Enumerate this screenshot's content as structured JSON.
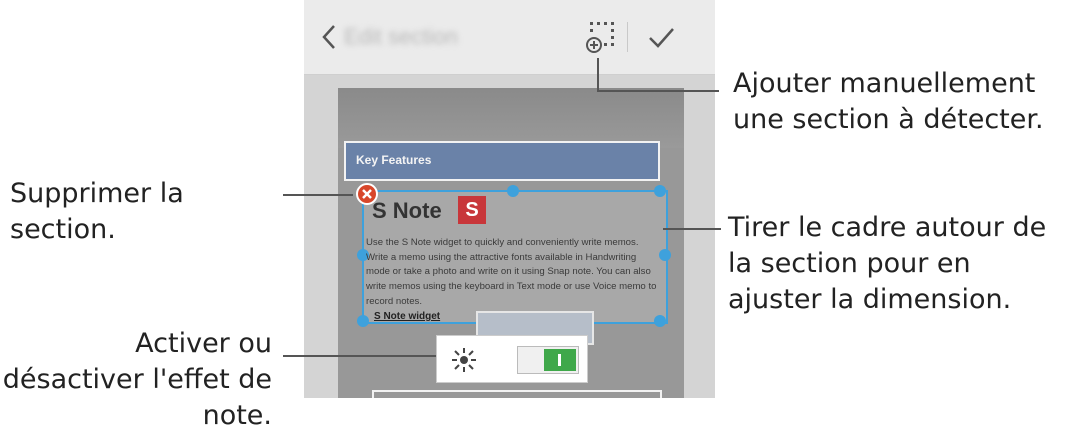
{
  "app": {
    "title": "Edit section",
    "back_label": "<",
    "add_section_icon": "add-section-icon",
    "done_icon": "checkmark-icon"
  },
  "document": {
    "key_features": "Key Features",
    "snote_title": "S Note",
    "snote_logo": "S",
    "snote_paragraph": "Use the S Note widget to quickly and conveniently write memos. Write a memo using the attractive fonts available in Handwriting mode or take a photo and write on it using Snap note. You can also write memos using the keyboard in Text mode or use Voice memo to record notes.",
    "snote_widget": "S Note widget"
  },
  "toggle": {
    "icon": "note-effect-icon",
    "state": "on"
  },
  "callouts": {
    "add_section": "Ajouter manuellement une section à détecter.",
    "delete_section": "Supprimer la section.",
    "drag_frame": "Tirer le cadre autour de la section pour en ajuster la dimension.",
    "toggle_effect": "Activer ou désactiver l'effet de note."
  },
  "colors": {
    "selection": "#3ea1dc",
    "delete": "#d8472b",
    "switch_on": "#3fa84a"
  }
}
